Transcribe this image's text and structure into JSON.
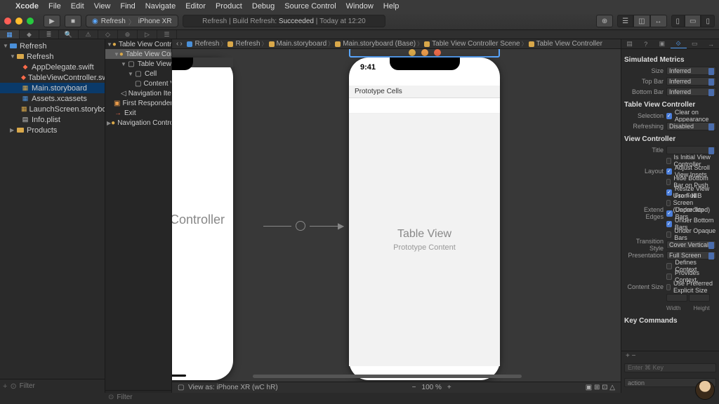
{
  "menubar": {
    "app": "Xcode",
    "items": [
      "File",
      "Edit",
      "View",
      "Find",
      "Navigate",
      "Editor",
      "Product",
      "Debug",
      "Source Control",
      "Window",
      "Help"
    ]
  },
  "toolbar": {
    "scheme_target": "Refresh",
    "scheme_device": "iPhone XR",
    "status_left": "Refresh | Build Refresh:",
    "status_result": "Succeeded",
    "status_time": "Today at 12:20"
  },
  "project_tree": {
    "root": "Refresh",
    "group": "Refresh",
    "files": [
      {
        "name": "AppDelegate.swift",
        "icon": "swift"
      },
      {
        "name": "TableViewController.swift",
        "icon": "swift"
      },
      {
        "name": "Main.storyboard",
        "icon": "sb",
        "selected": true
      },
      {
        "name": "Assets.xcassets",
        "icon": "asset"
      },
      {
        "name": "LaunchScreen.storyboard",
        "icon": "sb"
      },
      {
        "name": "Info.plist",
        "icon": "plist"
      }
    ],
    "products": "Products",
    "filter_placeholder": "Filter"
  },
  "outline": {
    "scene": "Table View Controller...",
    "items": [
      {
        "label": "Table View Controller",
        "depth": 1,
        "selected": true,
        "color": "#d9a84a"
      },
      {
        "label": "Table View",
        "depth": 2,
        "color": "#bbb"
      },
      {
        "label": "Cell",
        "depth": 3,
        "color": "#bbb"
      },
      {
        "label": "Content Vi...",
        "depth": 4,
        "color": "#bbb"
      },
      {
        "label": "Navigation Item",
        "depth": 2,
        "color": "#bbb"
      },
      {
        "label": "First Responder",
        "depth": 1,
        "color": "#e89a4a"
      },
      {
        "label": "Exit",
        "depth": 1,
        "color": "#e86a4a"
      }
    ],
    "nav_scene": "Navigation Controller..."
  },
  "breadcrumbs": [
    "Refresh",
    "Refresh",
    "Main.storyboard",
    "Main.storyboard (Base)",
    "Table View Controller Scene",
    "Table View Controller"
  ],
  "canvas": {
    "left_title": "ation Controller",
    "left_sub_visible": "igation Controller",
    "right_time": "9:41",
    "right_section": "Prototype Cells",
    "right_title": "Table View",
    "right_sub": "Prototype Content",
    "view_as": "View as: iPhone XR (wC hR)",
    "zoom": "100 %"
  },
  "inspector": {
    "sections": {
      "sim_metrics": {
        "title": "Simulated Metrics",
        "rows": [
          {
            "label": "Size",
            "value": "Inferred"
          },
          {
            "label": "Top Bar",
            "value": "Inferred"
          },
          {
            "label": "Bottom Bar",
            "value": "Inferred"
          }
        ]
      },
      "tvc": {
        "title": "Table View Controller",
        "selection_label": "Selection",
        "selection_check": "Clear on Appearance",
        "refreshing_label": "Refreshing",
        "refreshing_value": "Disabled"
      },
      "vc": {
        "title": "View Controller",
        "title_label": "Title",
        "initial": "Is Initial View Controller",
        "layout_label": "Layout",
        "layout_checks": [
          {
            "label": "Adjust Scroll View Insets",
            "on": true
          },
          {
            "label": "Hide Bottom Bar on Push",
            "on": false
          },
          {
            "label": "Resize View From NIB",
            "on": true
          },
          {
            "label": "Use Full Screen (Deprecated)",
            "on": false
          }
        ],
        "extend_label": "Extend Edges",
        "extend_checks": [
          {
            "label": "Under Top Bars",
            "on": true
          },
          {
            "label": "Under Bottom Bars",
            "on": true
          },
          {
            "label": "Under Opaque Bars",
            "on": false
          }
        ],
        "transition_label": "Transition Style",
        "transition_value": "Cover Vertical",
        "presentation_label": "Presentation",
        "presentation_value": "Full Screen",
        "ctx_checks": [
          {
            "label": "Defines Context",
            "on": false
          },
          {
            "label": "Provides Context",
            "on": false
          }
        ],
        "content_size_label": "Content Size",
        "content_size_check": "Use Preferred Explicit Size",
        "width_label": "Width",
        "height_label": "Height"
      },
      "keycmd": {
        "title": "Key Commands",
        "placeholder": "Enter ⌘ Key",
        "action": "action"
      }
    }
  }
}
